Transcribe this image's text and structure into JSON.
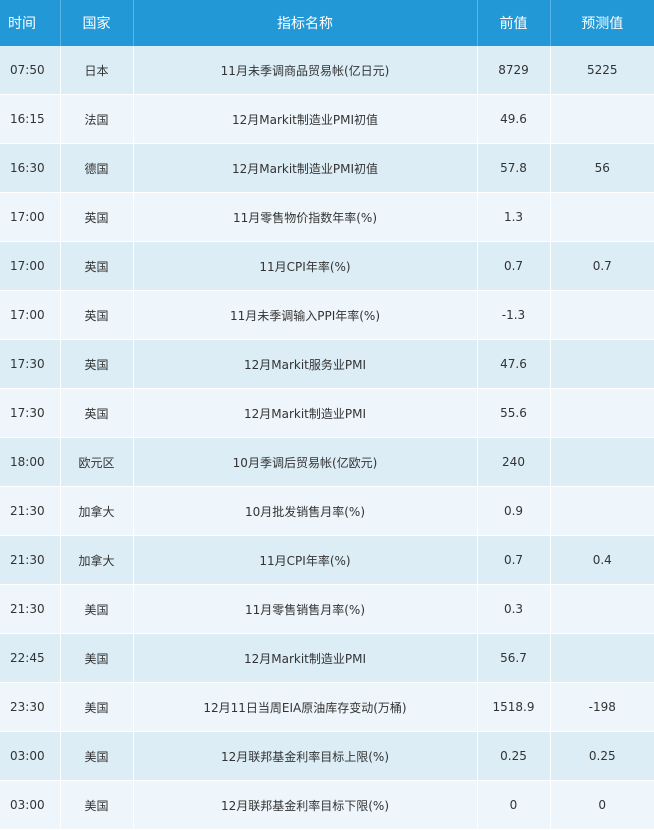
{
  "headers": {
    "time": "时间",
    "country": "国家",
    "indicator": "指标名称",
    "previous": "前值",
    "forecast": "预测值"
  },
  "rows": [
    {
      "time": "07:50",
      "country": "日本",
      "indicator": "11月未季调商品贸易帐(亿日元)",
      "previous": "8729",
      "forecast": "5225"
    },
    {
      "time": "16:15",
      "country": "法国",
      "indicator": "12月Markit制造业PMI初值",
      "previous": "49.6",
      "forecast": ""
    },
    {
      "time": "16:30",
      "country": "德国",
      "indicator": "12月Markit制造业PMI初值",
      "previous": "57.8",
      "forecast": "56"
    },
    {
      "time": "17:00",
      "country": "英国",
      "indicator": "11月零售物价指数年率(%)",
      "previous": "1.3",
      "forecast": ""
    },
    {
      "time": "17:00",
      "country": "英国",
      "indicator": "11月CPI年率(%)",
      "previous": "0.7",
      "forecast": "0.7"
    },
    {
      "time": "17:00",
      "country": "英国",
      "indicator": "11月未季调输入PPI年率(%)",
      "previous": "-1.3",
      "forecast": ""
    },
    {
      "time": "17:30",
      "country": "英国",
      "indicator": "12月Markit服务业PMI",
      "previous": "47.6",
      "forecast": ""
    },
    {
      "time": "17:30",
      "country": "英国",
      "indicator": "12月Markit制造业PMI",
      "previous": "55.6",
      "forecast": ""
    },
    {
      "time": "18:00",
      "country": "欧元区",
      "indicator": "10月季调后贸易帐(亿欧元)",
      "previous": "240",
      "forecast": ""
    },
    {
      "time": "21:30",
      "country": "加拿大",
      "indicator": "10月批发销售月率(%)",
      "previous": "0.9",
      "forecast": ""
    },
    {
      "time": "21:30",
      "country": "加拿大",
      "indicator": "11月CPI年率(%)",
      "previous": "0.7",
      "forecast": "0.4"
    },
    {
      "time": "21:30",
      "country": "美国",
      "indicator": "11月零售销售月率(%)",
      "previous": "0.3",
      "forecast": ""
    },
    {
      "time": "22:45",
      "country": "美国",
      "indicator": "12月Markit制造业PMI",
      "previous": "56.7",
      "forecast": ""
    },
    {
      "time": "23:30",
      "country": "美国",
      "indicator": "12月11日当周EIA原油库存变动(万桶)",
      "previous": "1518.9",
      "forecast": "-198"
    },
    {
      "time": "03:00",
      "country": "美国",
      "indicator": "12月联邦基金利率目标上限(%)",
      "previous": "0.25",
      "forecast": "0.25"
    },
    {
      "time": "03:00",
      "country": "美国",
      "indicator": "12月联邦基金利率目标下限(%)",
      "previous": "0",
      "forecast": "0"
    }
  ]
}
